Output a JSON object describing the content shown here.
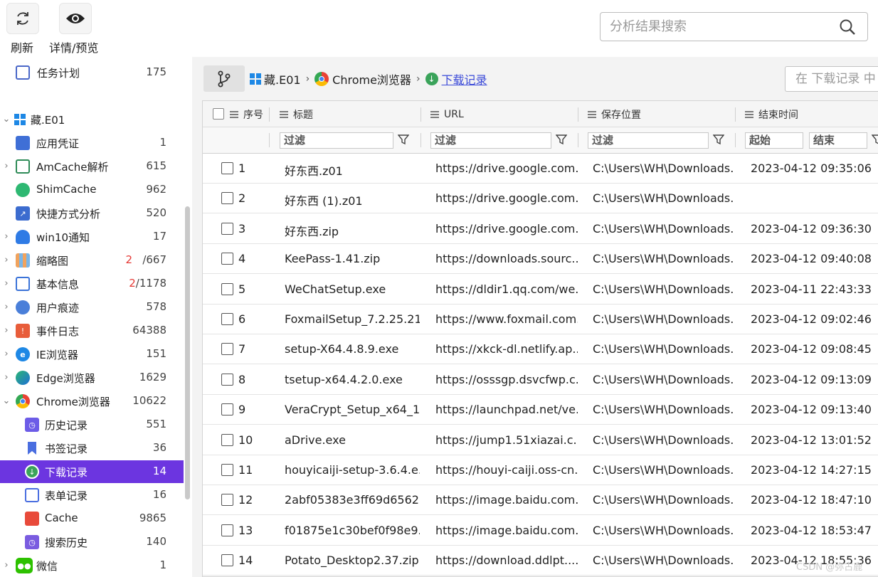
{
  "toolbar": {
    "refresh_label": "刷新",
    "details_label": "详情/预览",
    "search_placeholder": "分析结果搜索"
  },
  "sidebar": {
    "items": [
      {
        "label": "任务计划",
        "count": "175",
        "icon": "task-schedule-icon",
        "expandable": false
      },
      {
        "label": "藏.E01",
        "count": "",
        "icon": "windows-icon",
        "expandable": true
      },
      {
        "label": "应用凭证",
        "count": "1",
        "icon": "credential-icon",
        "expandable": false
      },
      {
        "label": "AmCache解析",
        "count": "615",
        "icon": "amcache-icon",
        "expandable": true
      },
      {
        "label": "ShimCache",
        "count": "962",
        "icon": "shimcache-icon",
        "expandable": false
      },
      {
        "label": "快捷方式分析",
        "count": "520",
        "icon": "shortcut-icon",
        "expandable": false
      },
      {
        "label": "win10通知",
        "count": "17",
        "icon": "notification-icon",
        "expandable": true
      },
      {
        "label": "缩略图",
        "count_red": "2",
        "count": "/667",
        "icon": "thumbnail-icon",
        "expandable": true
      },
      {
        "label": "基本信息",
        "count_red": "2",
        "count": "/1178",
        "icon": "basic-info-icon",
        "expandable": true
      },
      {
        "label": "用户痕迹",
        "count": "578",
        "icon": "user-trace-icon",
        "expandable": true
      },
      {
        "label": "事件日志",
        "count": "64388",
        "icon": "event-log-icon",
        "expandable": true
      },
      {
        "label": "IE浏览器",
        "count": "151",
        "icon": "ie-icon",
        "expandable": true
      },
      {
        "label": "Edge浏览器",
        "count": "1629",
        "icon": "edge-icon",
        "expandable": true
      },
      {
        "label": "Chrome浏览器",
        "count": "10622",
        "icon": "chrome-icon",
        "expandable": true
      },
      {
        "label": "历史记录",
        "count": "551",
        "icon": "history-icon",
        "expandable": false
      },
      {
        "label": "书签记录",
        "count": "36",
        "icon": "bookmark-icon",
        "expandable": false
      },
      {
        "label": "下载记录",
        "count": "14",
        "icon": "download-icon",
        "expandable": false
      },
      {
        "label": "表单记录",
        "count": "16",
        "icon": "form-icon",
        "expandable": false
      },
      {
        "label": "Cache",
        "count": "9865",
        "icon": "cache-icon",
        "expandable": false
      },
      {
        "label": "搜索历史",
        "count": "140",
        "icon": "search-history-icon",
        "expandable": false
      },
      {
        "label": "微信",
        "count": "1",
        "icon": "wechat-icon",
        "expandable": true
      }
    ]
  },
  "breadcrumb": {
    "items": [
      "藏.E01",
      "Chrome浏览器",
      "下载记录"
    ],
    "separator": "›"
  },
  "inner_search": {
    "placeholder": "在 下载记录 中"
  },
  "table": {
    "columns": [
      "序号",
      "标题",
      "URL",
      "保存位置",
      "结束时间"
    ],
    "filter_placeholder": "过滤",
    "time_start": "起始",
    "time_end": "结束",
    "rows": [
      {
        "no": "1",
        "title": "好东西.z01",
        "url": "https://drive.google.com...",
        "path": "C:\\Users\\WH\\Downloads...",
        "time": "2023-04-12 09:35:06"
      },
      {
        "no": "2",
        "title": "好东西 (1).z01",
        "url": "https://drive.google.com...",
        "path": "C:\\Users\\WH\\Downloads...",
        "time": ""
      },
      {
        "no": "3",
        "title": "好东西.zip",
        "url": "https://drive.google.com...",
        "path": "C:\\Users\\WH\\Downloads...",
        "time": "2023-04-12 09:36:30"
      },
      {
        "no": "4",
        "title": "KeePass-1.41.zip",
        "url": "https://downloads.sourc...",
        "path": "C:\\Users\\WH\\Downloads...",
        "time": "2023-04-12 09:40:08"
      },
      {
        "no": "5",
        "title": "WeChatSetup.exe",
        "url": "https://dldir1.qq.com/we...",
        "path": "C:\\Users\\WH\\Downloads...",
        "time": "2023-04-11 22:43:33"
      },
      {
        "no": "6",
        "title": "FoxmailSetup_7.2.25.21...",
        "url": "https://www.foxmail.com...",
        "path": "C:\\Users\\WH\\Downloads...",
        "time": "2023-04-12 09:02:46"
      },
      {
        "no": "7",
        "title": "setup-X64.4.8.9.exe",
        "url": "https://xkck-dl.netlify.ap...",
        "path": "C:\\Users\\WH\\Downloads...",
        "time": "2023-04-12 09:08:45"
      },
      {
        "no": "8",
        "title": "tsetup-x64.4.2.0.exe",
        "url": "https://osssgp.dsvcfwp.c...",
        "path": "C:\\Users\\WH\\Downloads...",
        "time": "2023-04-12 09:13:09"
      },
      {
        "no": "9",
        "title": "VeraCrypt_Setup_x64_1....",
        "url": "https://launchpad.net/ve...",
        "path": "C:\\Users\\WH\\Downloads...",
        "time": "2023-04-12 09:13:40"
      },
      {
        "no": "10",
        "title": "aDrive.exe",
        "url": "https://jump1.51xiazai.c...",
        "path": "C:\\Users\\WH\\Downloads...",
        "time": "2023-04-12 13:01:52"
      },
      {
        "no": "11",
        "title": "houyicaiji-setup-3.6.4.e...",
        "url": "https://houyi-caiji.oss-cn...",
        "path": "C:\\Users\\WH\\Downloads...",
        "time": "2023-04-12 14:27:15"
      },
      {
        "no": "12",
        "title": "2abf05383e3ff69d6562...",
        "url": "https://image.baidu.com...",
        "path": "C:\\Users\\WH\\Downloads...",
        "time": "2023-04-12 18:47:10"
      },
      {
        "no": "13",
        "title": "f01875e1c30bef0f98e9...",
        "url": "https://image.baidu.com...",
        "path": "C:\\Users\\WH\\Downloads...",
        "time": "2023-04-12 18:53:47"
      },
      {
        "no": "14",
        "title": "Potato_Desktop2.37.zip",
        "url": "https://download.ddlpt....",
        "path": "C:\\Users\\WH\\Downloads...",
        "time": "2023-04-12 18:55:36"
      }
    ]
  },
  "watermark": "CSDN @弥古鹿",
  "colors": {
    "accent": "#6c35e0",
    "link": "#3a49d8",
    "count_alert": "#e53935"
  }
}
